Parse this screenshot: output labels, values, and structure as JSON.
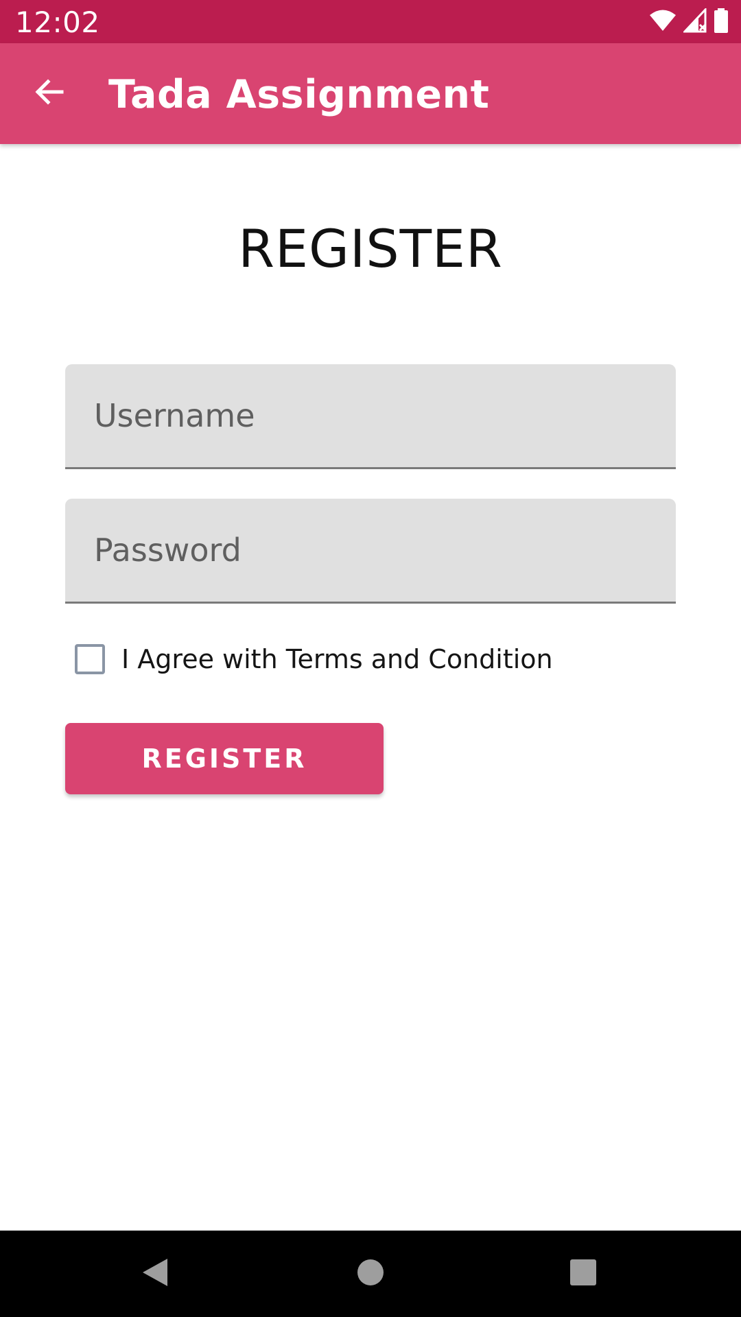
{
  "status_bar": {
    "time": "12:02",
    "icons": [
      "wifi-icon",
      "cell-signal-icon",
      "battery-icon"
    ]
  },
  "app_bar": {
    "title": "Tada Assignment",
    "back_icon": "arrow-back-icon"
  },
  "form": {
    "heading": "REGISTER",
    "username_placeholder": "Username",
    "username_value": "",
    "password_placeholder": "Password",
    "password_value": "",
    "terms_label": "I Agree with Terms and Condition",
    "terms_checked": false,
    "submit_label": "REGISTER"
  },
  "nav_bar": {
    "icons": [
      "nav-back-icon",
      "nav-home-icon",
      "nav-recents-icon"
    ]
  },
  "colors": {
    "status_bar": "#bb1d4f",
    "primary": "#d94471",
    "field_background": "#e0e0e0",
    "nav_bar": "#000000"
  }
}
